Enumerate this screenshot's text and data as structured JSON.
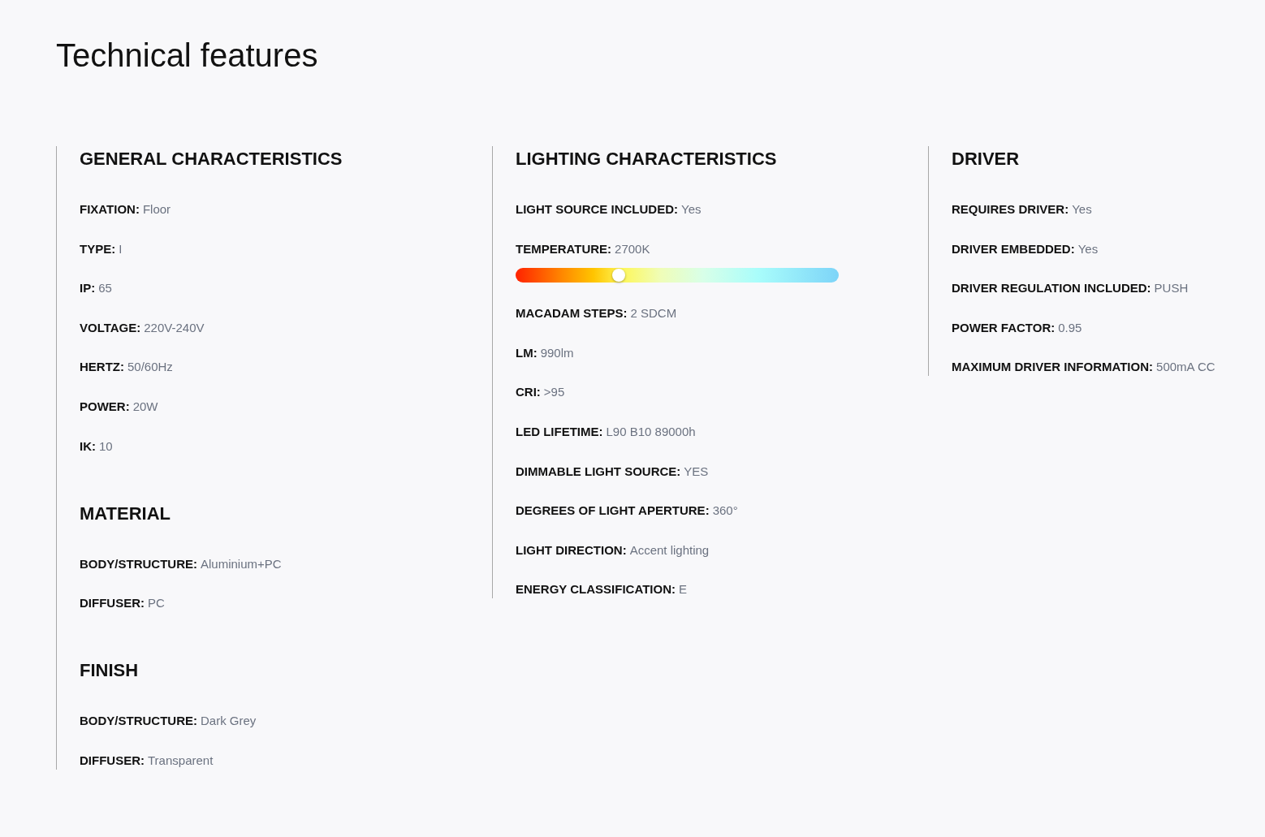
{
  "title": "Technical features",
  "columns": [
    {
      "sections": [
        {
          "title": "GENERAL CHARACTERISTICS",
          "items": [
            {
              "kind": "text",
              "label": "FIXATION:",
              "value": "Floor"
            },
            {
              "kind": "text",
              "label": "TYPE:",
              "value": "I"
            },
            {
              "kind": "text",
              "label": "IP:",
              "value": "65"
            },
            {
              "kind": "text",
              "label": "VOLTAGE:",
              "value": "220V-240V"
            },
            {
              "kind": "text",
              "label": "HERTZ:",
              "value": "50/60Hz"
            },
            {
              "kind": "text",
              "label": "POWER:",
              "value": "20W"
            },
            {
              "kind": "text",
              "label": "IK:",
              "value": "10"
            }
          ]
        },
        {
          "title": "MATERIAL",
          "items": [
            {
              "kind": "text",
              "label": "BODY/STRUCTURE:",
              "value": "Aluminium+PC"
            },
            {
              "kind": "text",
              "label": "DIFFUSER:",
              "value": "PC"
            }
          ]
        },
        {
          "title": "FINISH",
          "items": [
            {
              "kind": "text",
              "label": "BODY/STRUCTURE:",
              "value": "Dark Grey"
            },
            {
              "kind": "text",
              "label": "DIFFUSER:",
              "value": "Transparent"
            }
          ]
        }
      ]
    },
    {
      "sections": [
        {
          "title": "LIGHTING CHARACTERISTICS",
          "items": [
            {
              "kind": "text",
              "label": "LIGHT SOURCE INCLUDED:",
              "value": "Yes"
            },
            {
              "kind": "slider",
              "label": "TEMPERATURE:",
              "value": "2700K",
              "level": 0.32
            },
            {
              "kind": "text",
              "label": "MACADAM STEPS:",
              "value": "2 SDCM"
            },
            {
              "kind": "text",
              "label": "LM:",
              "value": "990lm"
            },
            {
              "kind": "text",
              "label": "CRI:",
              "value": ">95"
            },
            {
              "kind": "text",
              "label": "LED LIFETIME:",
              "value": "L90 B10 89000h"
            },
            {
              "kind": "text",
              "label": "DIMMABLE LIGHT SOURCE:",
              "value": "YES"
            },
            {
              "kind": "text",
              "label": "DEGREES OF LIGHT APERTURE:",
              "value": "360°"
            },
            {
              "kind": "text",
              "label": "LIGHT DIRECTION:",
              "value": "Accent lighting"
            },
            {
              "kind": "text",
              "label": "ENERGY CLASSIFICATION:",
              "value": "E"
            }
          ]
        }
      ]
    },
    {
      "sections": [
        {
          "title": "DRIVER",
          "items": [
            {
              "kind": "text",
              "label": "REQUIRES DRIVER:",
              "value": "Yes"
            },
            {
              "kind": "text",
              "label": "DRIVER EMBEDDED:",
              "value": "Yes"
            },
            {
              "kind": "text",
              "label": "DRIVER REGULATION INCLUDED:",
              "value": "PUSH"
            },
            {
              "kind": "text",
              "label": "POWER FACTOR:",
              "value": "0.95"
            },
            {
              "kind": "text",
              "label": "MAXIMUM DRIVER INFORMATION:",
              "value": "500mA CC"
            }
          ]
        }
      ]
    }
  ]
}
